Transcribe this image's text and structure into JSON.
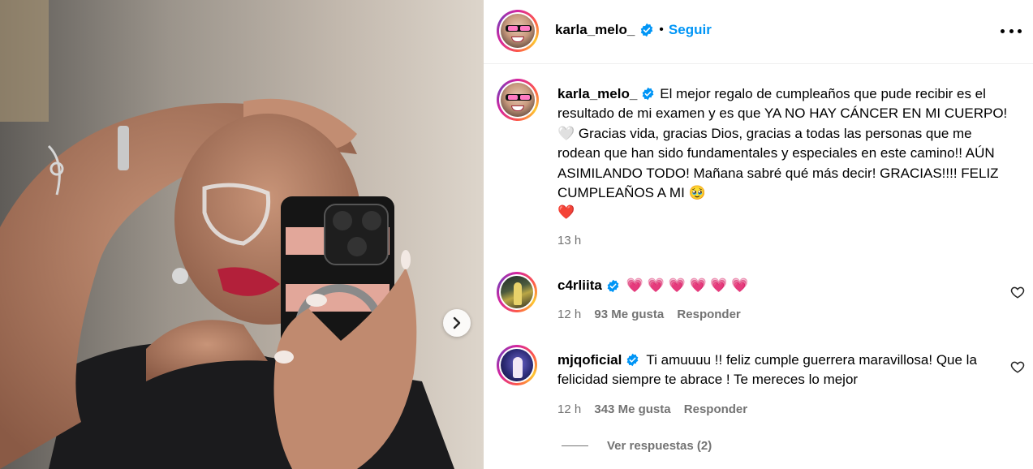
{
  "photo": {
    "next_button_icon": "chevron-right-icon"
  },
  "header": {
    "username": "karla_melo_",
    "separator": "•",
    "follow_label": "Seguir",
    "more_icon": "more-horizontal-icon"
  },
  "caption": {
    "username": "karla_melo_",
    "text_part1": "El mejor regalo de cumpleaños que pude recibir es el resultado de mi examen y es que YA NO HAY CÁNCER EN MI CUERPO! ",
    "emoji1": "🤍",
    "text_part2": " Gracias vida, gracias Dios, gracias a todas las personas que me rodean que han sido fundamentales y especiales en este camino!! AÚN ASIMILANDO TODO! Mañana sabré qué más decir! GRACIAS!!!! FELIZ CUMPLEAÑOS A MI ",
    "emoji2": "🥹",
    "emoji3": "❤️",
    "time": "13 h"
  },
  "comments": [
    {
      "username": "c4rliita",
      "text": "💗 💗 💗 💗 💗 💗",
      "time": "12 h",
      "likes": "93 Me gusta",
      "reply_label": "Responder"
    },
    {
      "username": "mjqoficial",
      "text": "Ti amuuuu !! feliz cumple guerrera maravillosa! Que la felicidad siempre te abrace ! Te mereces lo mejor",
      "time": "12 h",
      "likes": "343 Me gusta",
      "reply_label": "Responder"
    }
  ],
  "view_replies": "Ver respuestas (2)",
  "colors": {
    "link_blue": "#0095f6",
    "verified_blue": "#0095f6",
    "meta_gray": "#737373",
    "heart_pink": "#ee2a5a"
  }
}
